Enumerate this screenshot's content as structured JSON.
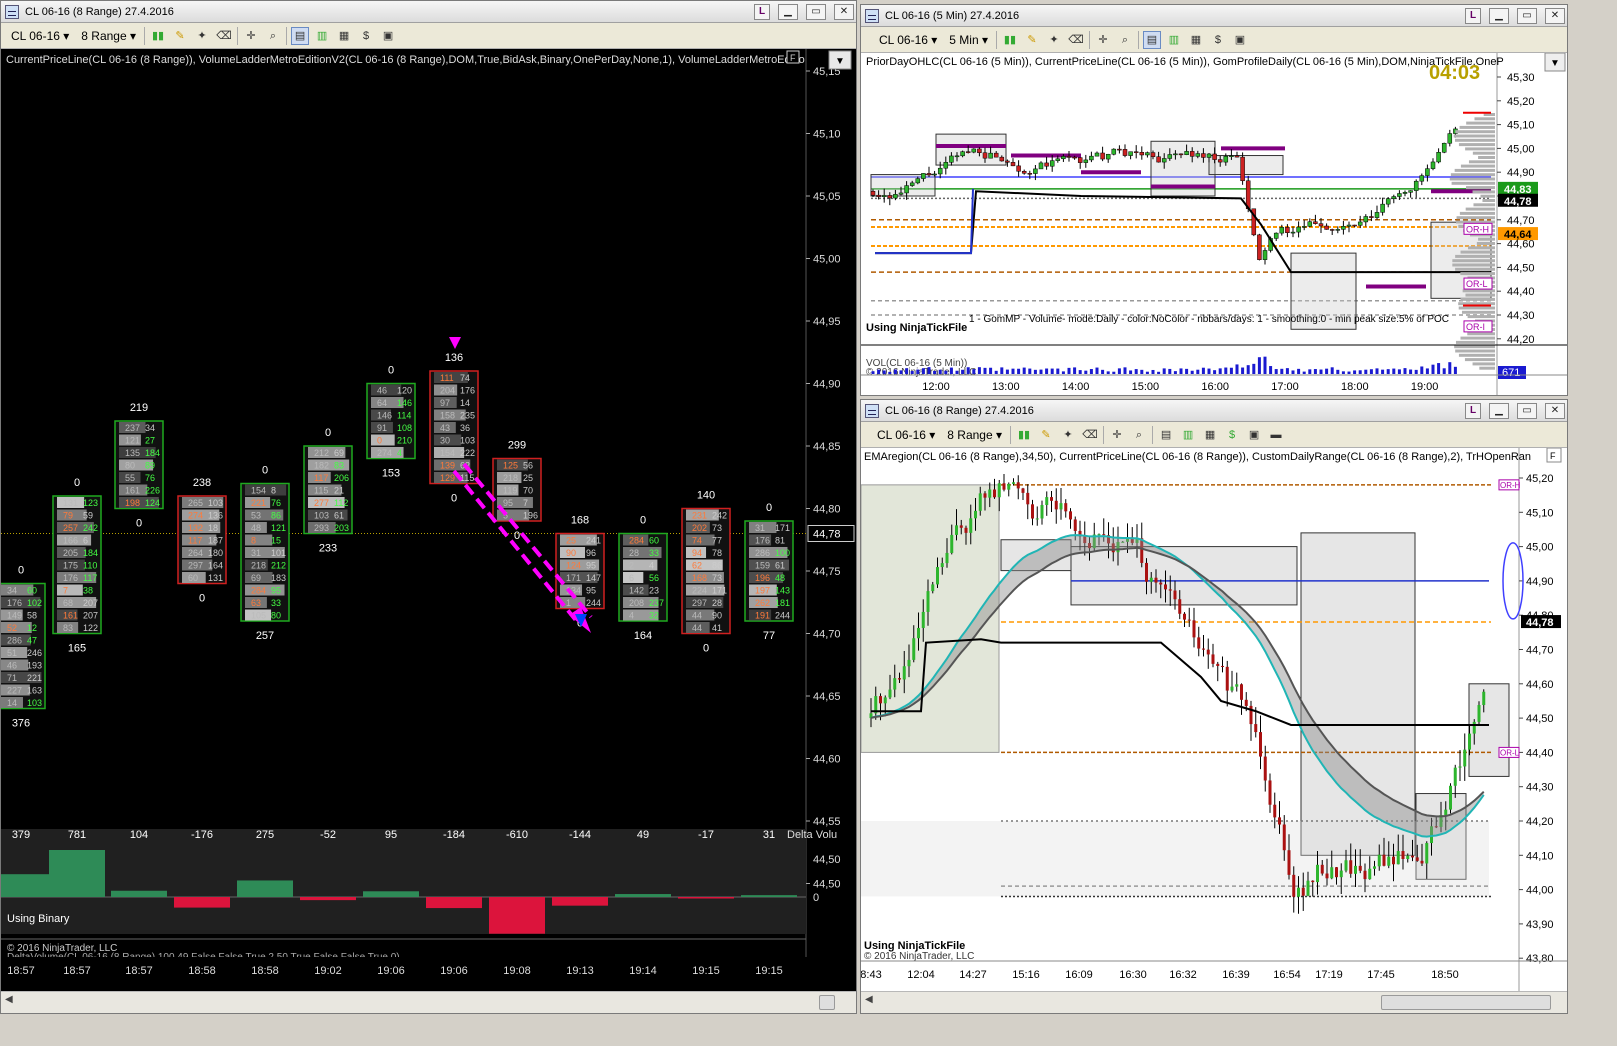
{
  "windows": {
    "left": {
      "title": "CL 06-16 (8 Range)  27.4.2016",
      "instrument": "CL 06-16",
      "interval": "8 Range",
      "indicator_line": "CurrentPriceLine(CL 06-16 (8 Range)), VolumeLadderMetroEditionV2(CL 06-16 (8 Range),DOM,True,BidAsk,Binary,OnePerDay,None,1), VolumeLadderMetroEditio",
      "bottom_label": "Using Binary",
      "copyright": "© 2016 NinjaTrader, LLC",
      "bottom_params": "DeltaVolume(CL 06-16 (8 Range) 100 49 False False True 2 50 True False False True 0)",
      "delta_axis_label": "Delta Volu",
      "delta_zero": "0",
      "current_price": "44,78",
      "price_labels": [
        "45,15",
        "45,10",
        "45,05",
        "45,00",
        "44,95",
        "44,90",
        "44,85",
        "44,80",
        "44,75",
        "44,70",
        "44,65",
        "44,60",
        "44,55",
        "44,50"
      ],
      "time_labels": [
        "18:57",
        "18:57",
        "18:57",
        "18:58",
        "18:58",
        "19:02",
        "19:06",
        "19:06",
        "19:08",
        "19:13",
        "19:14",
        "19:15",
        "19:15"
      ],
      "delta_values": [
        "379",
        "781",
        "104",
        "-176",
        "275",
        "-52",
        "95",
        "-184",
        "-610",
        "-144",
        "49",
        "-17",
        "31"
      ],
      "bar_top_labels": [
        "0",
        "0",
        "219",
        "238",
        "0",
        "0",
        "0",
        "136",
        "299",
        "168",
        "0",
        "140",
        "0"
      ],
      "bar_bottom_labels": [
        "376",
        "165",
        "0",
        "0",
        "257",
        "233",
        "153",
        "0",
        "0",
        "0",
        "164",
        "0",
        "77"
      ]
    },
    "top_right": {
      "title": "CL 06-16 (5 Min)  27.4.2016",
      "instrument": "CL 06-16",
      "interval": "5 Min",
      "indicator_line": "PriorDayOHLC(CL 06-16 (5 Min)), CurrentPriceLine(CL 06-16 (5 Min)), GomProfileDaily(CL 06-16 (5 Min),DOM,NinjaTickFile,OneP",
      "timer": "04:03",
      "gom_label": "1 - GomMP - Volume- mode:Daily - color:NoColor - nbbars/days: 1 - smoothing:0 - min peak size:5% of POC",
      "tick_label": "Using NinjaTickFile",
      "vol_label": "VOL(CL 06-16 (5 Min))",
      "copyright": "© 2016 NinjaTrader, LLC",
      "price_labels": [
        "45,30",
        "45,20",
        "45,10",
        "45,00",
        "44,90",
        "44,80",
        "44,70",
        "44,60",
        "44,50",
        "44,40",
        "44,30",
        "44,20"
      ],
      "badges": {
        "green": "44,83",
        "black": "44,78",
        "orange": "44,64",
        "volume": "671"
      },
      "or_labels": [
        "OR-H",
        "OR-L",
        "OR-I"
      ],
      "time_labels": [
        "12:00",
        "13:00",
        "14:00",
        "15:00",
        "16:00",
        "17:00",
        "18:00",
        "19:00"
      ]
    },
    "bottom_right": {
      "title": "CL 06-16 (8 Range)  27.4.2016",
      "instrument": "CL 06-16",
      "interval": "8 Range",
      "indicator_line": "EMAregion(CL 06-16 (8 Range),34,50), CurrentPriceLine(CL 06-16 (8 Range)), CustomDailyRange(CL 06-16 (8 Range),2), TrHOpenRan",
      "tick_label": "Using NinjaTickFile",
      "copyright": "© 2016 NinjaTrader, LLC",
      "current_price": "44,78",
      "or_labels": [
        "OR-H",
        "OR-L"
      ],
      "price_labels": [
        "45,20",
        "45,10",
        "45,00",
        "44,90",
        "44,80",
        "44,70",
        "44,60",
        "44,50",
        "44,40",
        "44,30",
        "44,20",
        "44,10",
        "44,00",
        "43,90",
        "43,80"
      ],
      "time_labels": [
        "8:43",
        "12:04",
        "14:27",
        "15:16",
        "16:09",
        "16:30",
        "16:32",
        "16:39",
        "16:54",
        "17:19",
        "17:45",
        "18:50"
      ]
    }
  },
  "toolbar_icons": [
    "bars-style-icon",
    "pencil-icon",
    "pin-icon",
    "eraser-icon",
    "crosshair-icon",
    "zoom-icon",
    "data-box-icon",
    "chart-trader-icon",
    "properties-icon",
    "money-icon",
    "share-icon"
  ],
  "colors": {
    "bull": "#22aa22",
    "bear": "#cc2222",
    "delta_pos": "#2e8b57",
    "delta_neg": "#dc143c",
    "magenta": "#ff00ff",
    "orange": "#ff9900"
  }
}
